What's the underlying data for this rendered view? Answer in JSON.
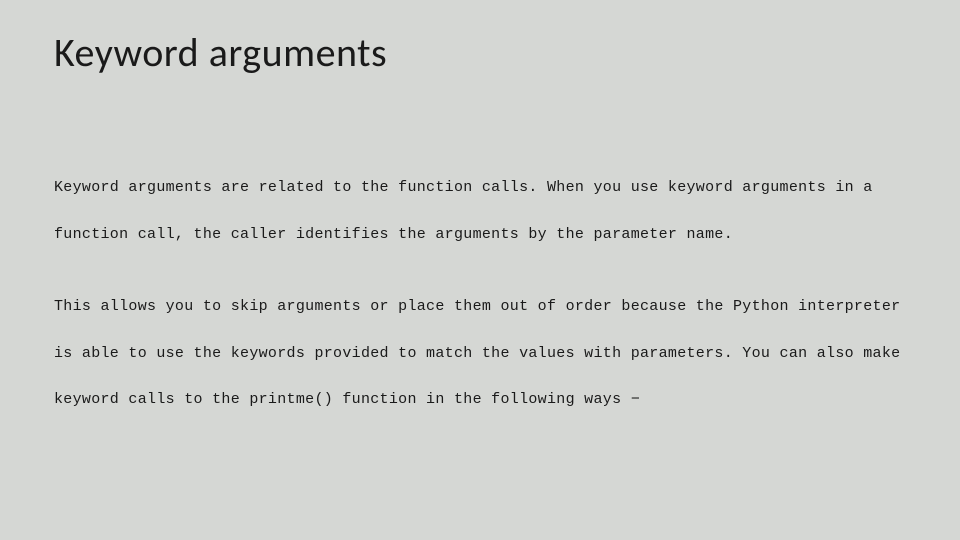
{
  "slide": {
    "title": "Keyword arguments",
    "paragraph1": "Keyword arguments are related to the function calls. When you use keyword arguments in a function call, the caller identifies the arguments by the parameter name.",
    "paragraph2": "This allows you to skip arguments or place them out of order because the Python interpreter is able to use the keywords provided to match the values with parameters. You can also make keyword calls to the printme() function in the following ways −"
  }
}
